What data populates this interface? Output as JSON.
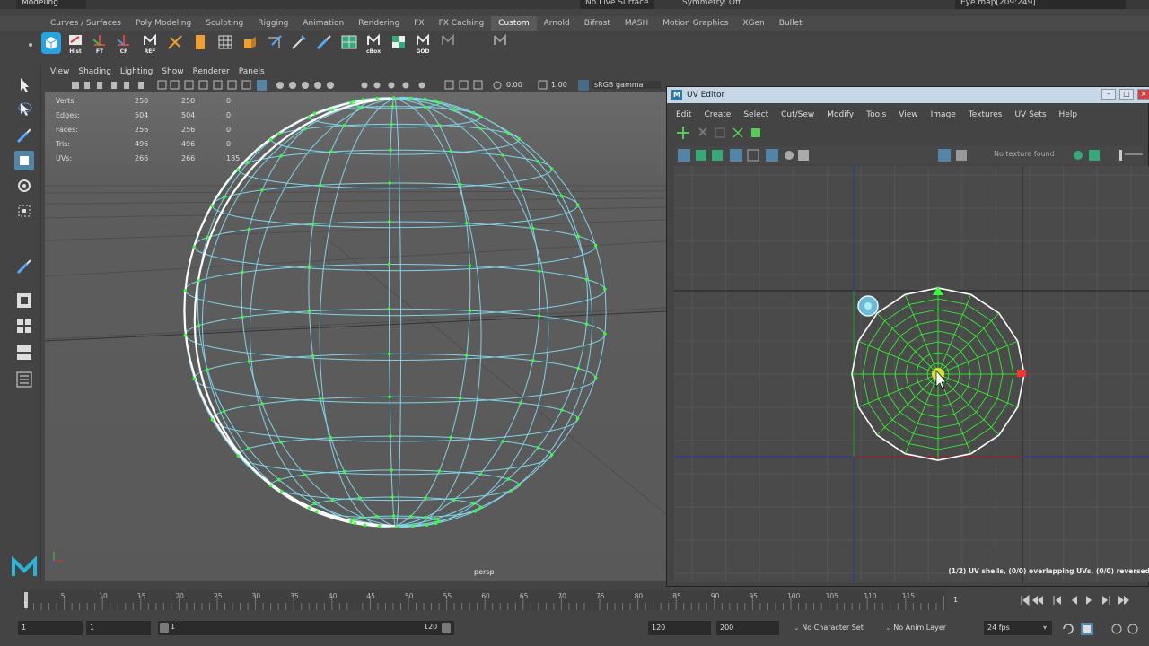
{
  "topbar": {
    "mode": "Modeling",
    "live_surface": "No Live Surface",
    "symmetry": "Symmetry: Off",
    "file_name": "Eye.map[209:249]"
  },
  "shelf_tabs": [
    {
      "label": "Curves / Surfaces"
    },
    {
      "label": "Poly Modeling"
    },
    {
      "label": "Sculpting"
    },
    {
      "label": "Rigging"
    },
    {
      "label": "Animation"
    },
    {
      "label": "Rendering"
    },
    {
      "label": "FX"
    },
    {
      "label": "FX Caching"
    },
    {
      "label": "Custom",
      "active": true
    },
    {
      "label": "Arnold"
    },
    {
      "label": "Bifrost"
    },
    {
      "label": "MASH"
    },
    {
      "label": "Motion Graphics"
    },
    {
      "label": "XGen"
    },
    {
      "label": "Bullet"
    }
  ],
  "shelf_labels": {
    "hist": "Hist",
    "ft": "FT",
    "cp": "CP",
    "ref": "REF",
    "cbox": "cBox",
    "god": "GOD"
  },
  "viewport": {
    "menu": [
      "View",
      "Shading",
      "Lighting",
      "Show",
      "Renderer",
      "Panels"
    ],
    "value_a": "0.00",
    "value_b": "1.00",
    "color_space": "sRGB gamma",
    "camera": "persp",
    "hud": [
      {
        "label": "Verts:",
        "v1": "250",
        "v2": "250",
        "v3": "0"
      },
      {
        "label": "Edges:",
        "v1": "504",
        "v2": "504",
        "v3": "0"
      },
      {
        "label": "Faces:",
        "v1": "256",
        "v2": "256",
        "v3": "0"
      },
      {
        "label": "Tris:",
        "v1": "496",
        "v2": "496",
        "v3": "0"
      },
      {
        "label": "UVs:",
        "v1": "266",
        "v2": "266",
        "v3": "185"
      }
    ]
  },
  "uv_editor": {
    "title": "UV Editor",
    "menu": [
      "Edit",
      "Create",
      "Select",
      "Cut/Sew",
      "Modify",
      "Tools",
      "View",
      "Image",
      "Textures",
      "UV Sets",
      "Help"
    ],
    "texture_status": "No texture found",
    "status": "(1/2) UV shells, (0/0) overlapping UVs, (0/0) reversed"
  },
  "timeline": {
    "ticks": [
      "5",
      "10",
      "15",
      "20",
      "25",
      "30",
      "35",
      "40",
      "45",
      "50",
      "55",
      "60",
      "65",
      "70",
      "75",
      "80",
      "85",
      "90",
      "95",
      "100",
      "105",
      "110",
      "115"
    ],
    "first_tick": "1",
    "current_frame": "1"
  },
  "range": {
    "start": "1",
    "current": "1",
    "inner_start": "1",
    "inner_end": "120",
    "end": "120",
    "max_end": "200",
    "character_set": "No Character Set",
    "anim_layer": "No Anim Layer",
    "fps": "24 fps"
  },
  "colors": {
    "accent": "#5285a6",
    "wire": "#7fd4e6",
    "vertex": "#33ff33",
    "uv_grid": "#2aff2a",
    "selected_edge": "#ffffff"
  }
}
